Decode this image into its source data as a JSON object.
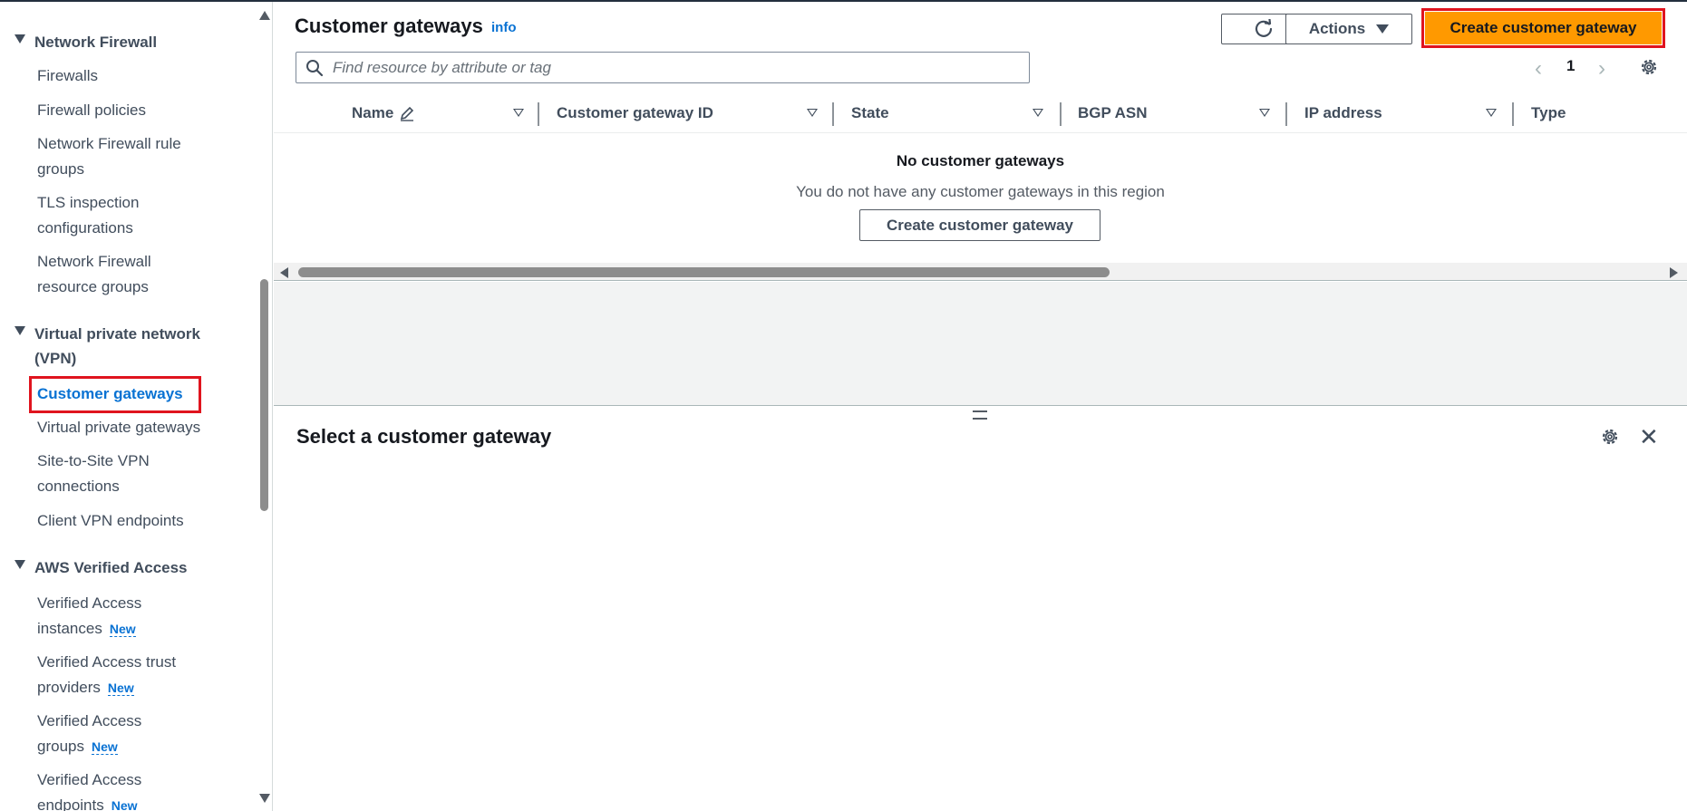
{
  "sidebar": {
    "sections": [
      {
        "title": "Network Firewall",
        "items": [
          "Firewalls",
          "Firewall policies",
          "Network Firewall rule groups",
          "TLS inspection configurations",
          "Network Firewall resource groups"
        ]
      },
      {
        "title": "Virtual private network (VPN)",
        "items": [
          "Customer gateways",
          "Virtual private gateways",
          "Site-to-Site VPN connections",
          "Client VPN endpoints"
        ]
      },
      {
        "title": "AWS Verified Access",
        "items": [
          "Verified Access instances",
          "Verified Access trust providers",
          "Verified Access groups",
          "Verified Access endpoints"
        ]
      }
    ],
    "new_badge": "New",
    "active_item": "Customer gateways"
  },
  "header": {
    "title": "Customer gateways",
    "info": "info",
    "actions_label": "Actions",
    "create_label": "Create customer gateway"
  },
  "search": {
    "placeholder": "Find resource by attribute or tag"
  },
  "pagination": {
    "page": "1"
  },
  "table": {
    "columns": [
      "Name",
      "Customer gateway ID",
      "State",
      "BGP ASN",
      "IP address",
      "Type"
    ],
    "empty_title": "No customer gateways",
    "empty_subtitle": "You do not have any customer gateways in this region",
    "empty_action": "Create customer gateway"
  },
  "detail": {
    "title": "Select a customer gateway"
  },
  "colors": {
    "accent": "#ff9900",
    "link": "#0972d3",
    "highlight": "#e0141e"
  }
}
